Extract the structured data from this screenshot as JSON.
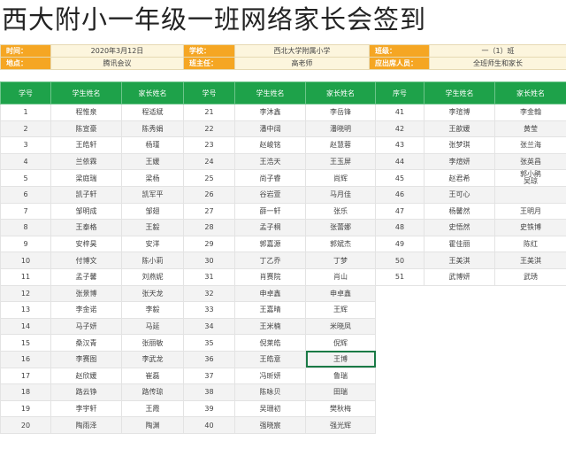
{
  "title": "西大附小一年级一班网络家长会签到",
  "info": {
    "row1": [
      {
        "label": "时间：",
        "value": "2020年3月12日"
      },
      {
        "label": "学校：",
        "value": "西北大学附属小学"
      },
      {
        "label": "班级：",
        "value": "一（1）班"
      }
    ],
    "row2": [
      {
        "label": "地点：",
        "value": "腾讯会议"
      },
      {
        "label": "班主任：",
        "value": "高老师"
      },
      {
        "label": "应出席人员：",
        "value": "全班师生和家长"
      }
    ]
  },
  "headers": [
    "学号",
    "学生姓名",
    "家长姓名",
    "学号",
    "学生姓名",
    "家长姓名",
    "序号",
    "学生姓名",
    "家长姓名"
  ],
  "rows": [
    [
      [
        "1",
        "程惟泉",
        "程适斌"
      ],
      [
        "21",
        "李沐鑫",
        "李岳锋"
      ],
      [
        "41",
        "李瑄博",
        "李金翰"
      ]
    ],
    [
      [
        "2",
        "陈宣豪",
        "陈秀娟"
      ],
      [
        "22",
        "潘中阔",
        "潘晓明"
      ],
      [
        "42",
        "王歆媛",
        "黄莹"
      ]
    ],
    [
      [
        "3",
        "王皓轩",
        "杨瑾"
      ],
      [
        "23",
        "赵峻铭",
        "赵慧蓉"
      ],
      [
        "43",
        "张梦琪",
        "张兰海"
      ]
    ],
    [
      [
        "4",
        "兰依霖",
        "王媛"
      ],
      [
        "24",
        "王浩天",
        "王玉屏"
      ],
      [
        "44",
        "李煊妍",
        "张英昌"
      ]
    ],
    [
      [
        "5",
        "梁庭瑞",
        "梁杨"
      ],
      [
        "25",
        "尚子睿",
        "尚辉"
      ],
      [
        "45",
        "赵君希",
        "郭小鹃|吴琼"
      ]
    ],
    [
      [
        "6",
        "凯子轩",
        "凯军平"
      ],
      [
        "26",
        "谷岩萱",
        "马月佳"
      ],
      [
        "46",
        "王可心",
        ""
      ]
    ],
    [
      [
        "7",
        "邹明成",
        "邹翅"
      ],
      [
        "27",
        "薛一轩",
        "张乐"
      ],
      [
        "47",
        "杨馨然",
        "王明月"
      ]
    ],
    [
      [
        "8",
        "王泰格",
        "王毅"
      ],
      [
        "28",
        "孟子桐",
        "张蕾娜"
      ],
      [
        "48",
        "史悟然",
        "史铁博"
      ]
    ],
    [
      [
        "9",
        "安梓昊",
        "安洋"
      ],
      [
        "29",
        "郭嘉源",
        "郭斌杰"
      ],
      [
        "49",
        "霍佳丽",
        "陈红"
      ]
    ],
    [
      [
        "10",
        "付博文",
        "陈小莉"
      ],
      [
        "30",
        "丁乙乔",
        "丁梦"
      ],
      [
        "50",
        "王美淇",
        "王美淇"
      ]
    ],
    [
      [
        "11",
        "孟子馨",
        "刘燕妮"
      ],
      [
        "31",
        "肖赛院",
        "肖山"
      ],
      [
        "51",
        "武博妍",
        "武琇"
      ]
    ],
    [
      [
        "12",
        "张景博",
        "张天龙"
      ],
      [
        "32",
        "申卓鑫",
        "申卓鑫"
      ],
      [
        "",
        "",
        " "
      ]
    ],
    [
      [
        "13",
        "李金诺",
        "李毅"
      ],
      [
        "33",
        "王嘉晴",
        "王辉"
      ],
      [
        "",
        "",
        ""
      ]
    ],
    [
      [
        "14",
        "马子妍",
        "马延"
      ],
      [
        "34",
        "王米楠",
        "米晓凤"
      ],
      [
        "",
        "",
        ""
      ]
    ],
    [
      [
        "15",
        "桑汉青",
        "张丽敏"
      ],
      [
        "35",
        "倪莱皓",
        "倪辉"
      ],
      [
        "",
        "",
        ""
      ]
    ],
    [
      [
        "16",
        "李赛图",
        "李武龙"
      ],
      [
        "36",
        "王皓意",
        "王博"
      ],
      [
        "",
        "",
        ""
      ]
    ],
    [
      [
        "17",
        "赵欣媛",
        "崔磊"
      ],
      [
        "37",
        "冯昕妍",
        "鲁瑞"
      ],
      [
        "",
        "",
        ""
      ]
    ],
    [
      [
        "18",
        "路云铮",
        "路传琼"
      ],
      [
        "38",
        "陈咏贝",
        "田瑞"
      ],
      [
        "",
        "",
        ""
      ]
    ],
    [
      [
        "19",
        "李宇轩",
        "王霞"
      ],
      [
        "39",
        "吴珊初",
        "樊秋梅"
      ],
      [
        "",
        "",
        ""
      ]
    ],
    [
      [
        "20",
        "陶雨泽",
        "陶渊"
      ],
      [
        "40",
        "强晓宸",
        "强光辉"
      ],
      [
        "",
        "",
        ""
      ]
    ]
  ]
}
